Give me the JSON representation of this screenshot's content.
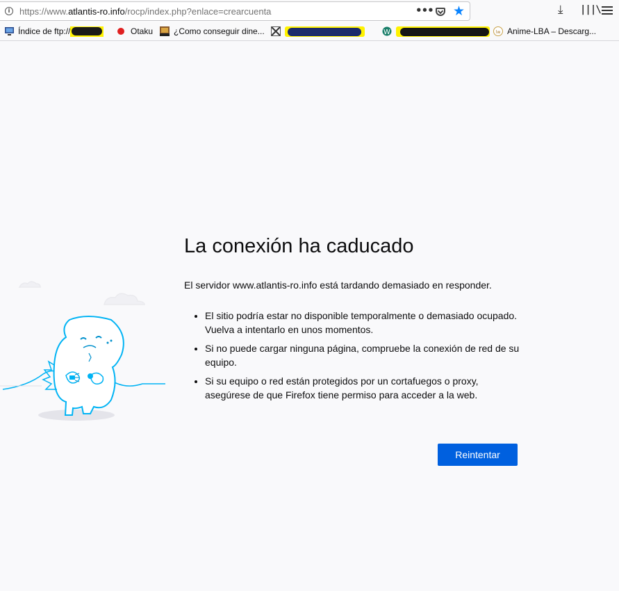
{
  "browser": {
    "url_scheme": "https://www.",
    "url_host": "atlantis-ro.info",
    "url_path": "/rocp/index.php?enlace=crearcuenta",
    "page_actions_icon": "more-horizontal-icon",
    "colors": {
      "star": "#0a84ff",
      "primary_button": "#0060df"
    }
  },
  "bookmarks": [
    {
      "label": "Índice de ftp://",
      "icon": "computer-icon"
    },
    {
      "label": "Otaku",
      "icon": "red-dot-icon"
    },
    {
      "label": "¿Como conseguir dine...",
      "icon": "image-favicon"
    },
    {
      "label": "",
      "icon": "cross-favicon"
    },
    {
      "label": "",
      "icon": "w-favicon"
    },
    {
      "label": "Anime-LBA – Descarg...",
      "icon": "lba-favicon"
    }
  ],
  "error": {
    "title": "La conexión ha caducado",
    "description": "El servidor www.atlantis-ro.info está tardando demasiado en responder.",
    "reasons": [
      "El sitio podría estar no disponible temporalmente o demasiado ocupado. Vuelva a intentarlo en unos momentos.",
      "Si no puede cargar ninguna página, compruebe la conexión de red de su equipo.",
      "Si su equipo o red están protegidos por un cortafuegos o proxy, asegúrese de que Firefox tiene permiso para acceder a la web."
    ],
    "retry_label": "Reintentar"
  }
}
